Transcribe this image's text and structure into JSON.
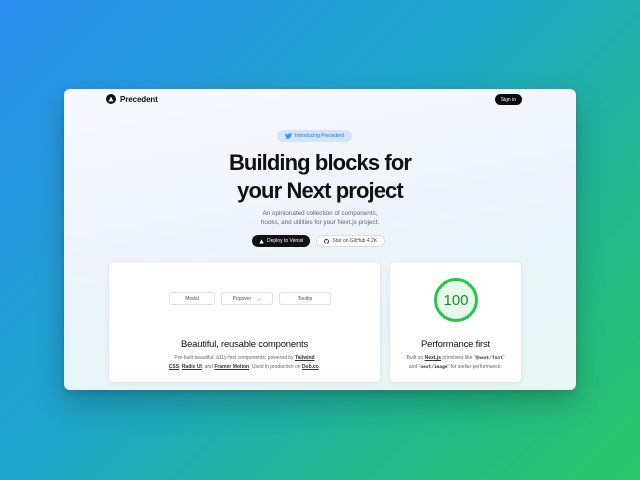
{
  "header": {
    "brand": "Precedent",
    "signin_label": "Sign in"
  },
  "hero": {
    "badge": "Introducing Precedent",
    "headline_line1": "Building blocks for",
    "headline_line2": "your Next project",
    "subtext_line1": "An opinionated collection of components,",
    "subtext_line2": "hooks, and utilities for your Next.js project.",
    "deploy_label": "Deploy to Vercel",
    "github_label": "Star on GitHub 4.2K"
  },
  "cards": {
    "components": {
      "demo_modal": "Modal",
      "demo_popover": "Popover",
      "demo_tooltip": "Tooltip",
      "title": "Beautiful, reusable components",
      "desc_1": "Pre-built beautiful, a11y-first components, powered by",
      "link_tailwind": "Tailwind",
      "link_css": "CSS",
      "sep_1": ",",
      "link_radix": "Radix UI",
      "and": ", and",
      "link_framer": "Framer Motion",
      "desc_2": ". Used in production on",
      "link_dub": "Dub.co",
      "period": "."
    },
    "performance": {
      "score": "100",
      "title": "Performance first",
      "desc_1": "Built on",
      "link_next": "Next.js",
      "desc_2": "primitives like",
      "code_font": "@next/font",
      "desc_3": "and",
      "code_image": "next/image",
      "desc_4": "for stellar performance."
    }
  },
  "colors": {
    "accent_blue": "#2a6fcf",
    "badge_bg": "#d2e4fb",
    "score_green": "#27c64a",
    "dark_button": "#111111"
  },
  "icons": {
    "logo": "triangle-logo-icon",
    "badge": "twitter-bird-icon",
    "deploy": "vercel-triangle-icon",
    "github": "github-icon",
    "chevron": "chevron-down-icon"
  }
}
